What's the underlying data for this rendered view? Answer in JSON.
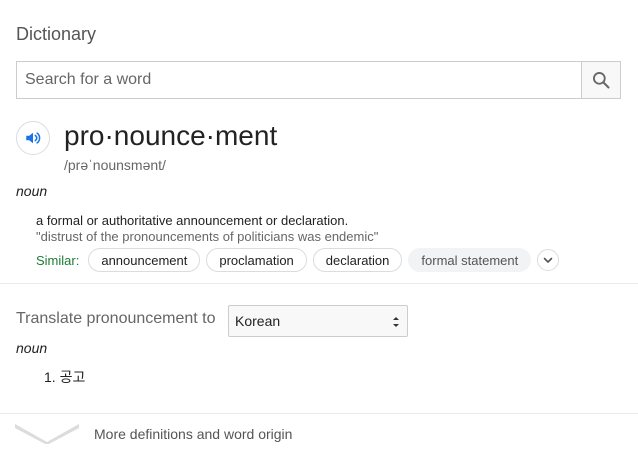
{
  "header": {
    "title": "Dictionary"
  },
  "search": {
    "placeholder": "Search for a word",
    "button_icon": "search-icon"
  },
  "entry": {
    "headword": "pro·nounce·ment",
    "phonetic": "/prəˈnounsmənt/",
    "pos": "noun",
    "definition": "a formal or authoritative announcement or declaration.",
    "example": "\"distrust of the pronouncements of politicians was endemic\"",
    "similar_label": "Similar:",
    "similar": [
      "announcement",
      "proclamation",
      "declaration",
      "formal statement"
    ],
    "speaker_icon": "speaker-icon"
  },
  "translate": {
    "label": "Translate pronouncement to",
    "language": "Korean",
    "pos": "noun",
    "items": [
      "1. 공고"
    ]
  },
  "footer": {
    "more_label": "More definitions and word origin"
  },
  "colors": {
    "accent": "#1a73e8",
    "similar_label": "#1e7b34",
    "muted": "#666666"
  }
}
